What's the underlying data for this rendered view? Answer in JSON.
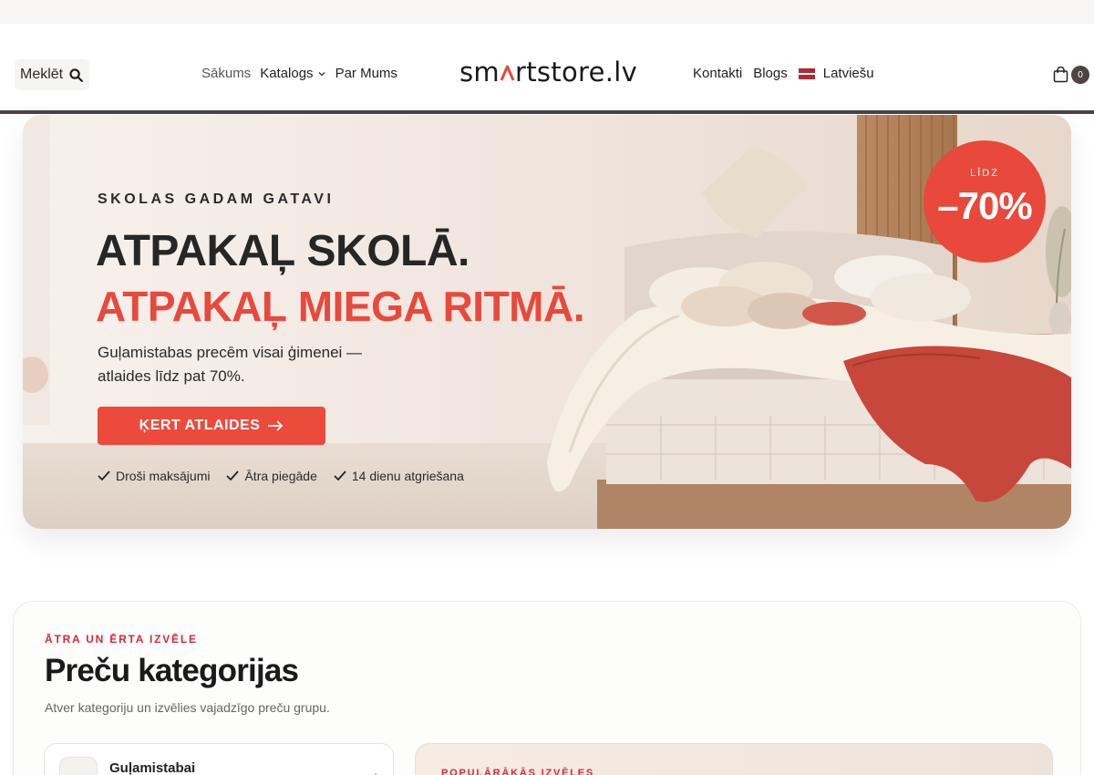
{
  "header": {
    "search_label": "Meklēt",
    "nav_left": [
      {
        "label": "Sākums"
      },
      {
        "label": "Katalogs"
      },
      {
        "label": "Par Mums"
      }
    ],
    "logo_text_before": "sm",
    "logo_text_after": "rtstore.lv",
    "nav_right": [
      {
        "label": "Kontakti"
      },
      {
        "label": "Blogs"
      },
      {
        "label": "Latviešu"
      }
    ],
    "cart_count": "0"
  },
  "hero": {
    "eyebrow": "SKOLAS GADAM GATAVI",
    "headline_1": "ATPAKAĻ SKOLĀ.",
    "headline_2": "ATPAKAĻ MIEGA RITMĀ.",
    "description": "Guļamistabas precēm visai ģimenei — atlaides līdz pat 70%.",
    "cta_label": "ĶERT ATLAIDES",
    "trust": [
      {
        "label": "Droši maksājumi"
      },
      {
        "label": "Ātra piegāde"
      },
      {
        "label": "14 dienu atgriešana"
      }
    ],
    "badge": {
      "top": "LĪDZ",
      "main": "–70%"
    }
  },
  "categories": {
    "eyebrow": "ĀTRA UN ĒRTA IZVĒLE",
    "title": "Preču kategorijas",
    "description": "Atver kategoriju un izvēlies vajadzīgo preču grupu.",
    "first_item": "Guļamistabai",
    "popular_eyebrow": "POPULĀRĀKĀS IZVĒLES"
  },
  "colors": {
    "accent": "#e9493d",
    "dark": "#4a4244",
    "eyebrow_red": "#d6293b"
  }
}
